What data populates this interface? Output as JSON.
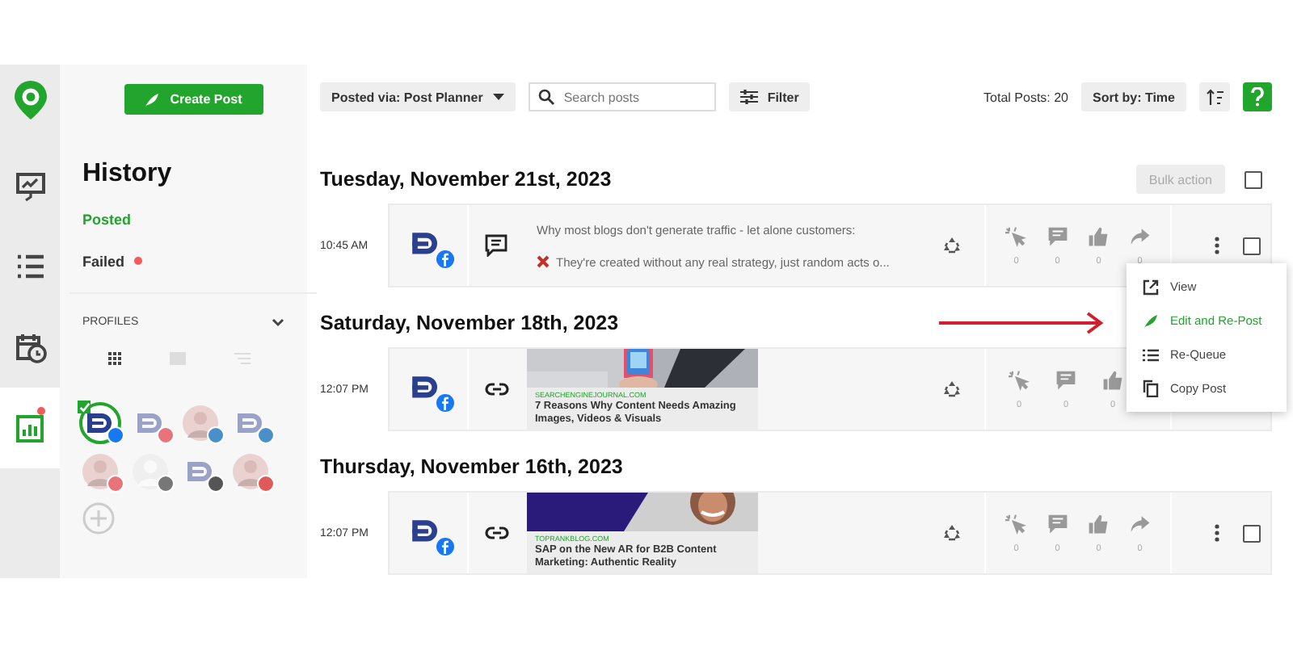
{
  "rail": {
    "items": [
      {
        "kind": "dashboard",
        "selected": false,
        "alert": false
      },
      {
        "kind": "list",
        "selected": false,
        "alert": false
      },
      {
        "kind": "calendar",
        "selected": false,
        "alert": false
      },
      {
        "kind": "analytics",
        "selected": true,
        "alert": true
      }
    ]
  },
  "sidebar": {
    "create_button": "Create Post",
    "title": "History",
    "nav": [
      {
        "label": "Posted",
        "selected": true,
        "alert": false
      },
      {
        "label": "Failed",
        "selected": false,
        "alert": true
      }
    ],
    "profiles_label": "PROFILES",
    "view_modes": [
      {
        "kind": "grid",
        "selected": true
      },
      {
        "kind": "tiles",
        "selected": false
      },
      {
        "kind": "lines",
        "selected": false
      }
    ],
    "profiles": [
      {
        "kind": "logo",
        "color": "#1877f2",
        "selected": true
      },
      {
        "kind": "logo",
        "color": "#e8737a",
        "selected": false
      },
      {
        "kind": "person",
        "color": "#4a90c8",
        "selected": false
      },
      {
        "kind": "logo",
        "color": "#4a90c8",
        "selected": false
      },
      {
        "kind": "person",
        "color": "#e8737a",
        "selected": false
      },
      {
        "kind": "blank",
        "color": "#777777",
        "selected": false
      },
      {
        "kind": "logo",
        "color": "#555555",
        "selected": false
      },
      {
        "kind": "person",
        "color": "#e05a5a",
        "selected": false
      }
    ]
  },
  "toolbar": {
    "source_filter": "Posted via: Post Planner",
    "search": {
      "placeholder": "Search posts"
    },
    "filter": "Filter",
    "total": "Total Posts: 20",
    "sort": "Sort by: Time"
  },
  "bulk_action": {
    "label": "Bulk action",
    "disabled": true,
    "checked": false
  },
  "days": [
    {
      "date": "Tuesday, November 21st, 2023",
      "arrow": false,
      "posts": [
        {
          "time": "10:45 AM",
          "kind": "text",
          "text": "Why most blogs don't generate traffic - let alone customers:",
          "text_2": "They're created without any real strategy, just random acts o...",
          "checked": false,
          "menu": [
            {
              "kind": "view",
              "label": "View",
              "selected": false
            },
            {
              "kind": "edit",
              "label": "Edit and Re-Post",
              "selected": true
            },
            {
              "kind": "requeue",
              "label": "Re-Queue",
              "selected": false
            },
            {
              "kind": "copy",
              "label": "Copy Post",
              "selected": false
            }
          ],
          "stats": [
            {
              "kind": "clicks",
              "count": "0"
            },
            {
              "kind": "comments",
              "count": "0"
            },
            {
              "kind": "likes",
              "count": "0"
            },
            {
              "kind": "shares",
              "count": "0"
            }
          ]
        }
      ]
    },
    {
      "date": "Saturday, November 18th, 2023",
      "arrow": true,
      "posts": [
        {
          "time": "12:07 PM",
          "kind": "link",
          "domain": "SEARCHENGINEJOURNAL.COM",
          "title": "7 Reasons Why Content Needs Amazing Images, Videos & Visuals",
          "stats": [
            {
              "kind": "clicks",
              "count": "0"
            },
            {
              "kind": "comments",
              "count": "0"
            },
            {
              "kind": "likes",
              "count": "0"
            }
          ]
        }
      ]
    },
    {
      "date": "Thursday, November 16th, 2023",
      "arrow": false,
      "posts": [
        {
          "time": "12:07 PM",
          "kind": "link",
          "domain": "TOPRANKBLOG.COM",
          "title": "SAP on the New AR for B2B Content Marketing: Authentic Reality",
          "checked": false,
          "stats": [
            {
              "kind": "clicks",
              "count": "0"
            },
            {
              "kind": "comments",
              "count": "0"
            },
            {
              "kind": "likes",
              "count": "0"
            },
            {
              "kind": "shares",
              "count": "0"
            }
          ]
        }
      ]
    }
  ]
}
